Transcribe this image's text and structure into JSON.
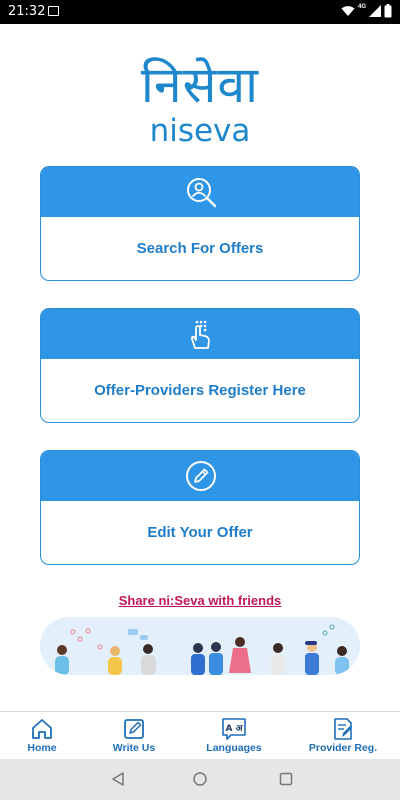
{
  "status_bar": {
    "time": "21:32",
    "network_label": "4G",
    "icons": [
      "image-icon",
      "wifi-icon",
      "signal-icon",
      "battery-icon"
    ]
  },
  "logo": {
    "devanagari": "निसेवा",
    "latin": "niseva"
  },
  "cards": [
    {
      "label": "Search For Offers",
      "icon": "search-person-icon"
    },
    {
      "label": "Offer-Providers Register Here",
      "icon": "tap-hand-icon"
    },
    {
      "label": "Edit Your Offer",
      "icon": "pencil-icon"
    }
  ],
  "share_link": "Share ni:Seva with friends",
  "bottom_nav": [
    {
      "label": "Home",
      "icon": "home-icon"
    },
    {
      "label": "Write Us",
      "icon": "edit-icon"
    },
    {
      "label": "Languages",
      "icon": "translate-icon",
      "icon_text": "A अ"
    },
    {
      "label": "Provider Reg.",
      "icon": "register-doc-icon"
    }
  ],
  "colors": {
    "primary": "#2f95e6",
    "text_blue": "#1f7dc9",
    "link": "#c2185b"
  }
}
